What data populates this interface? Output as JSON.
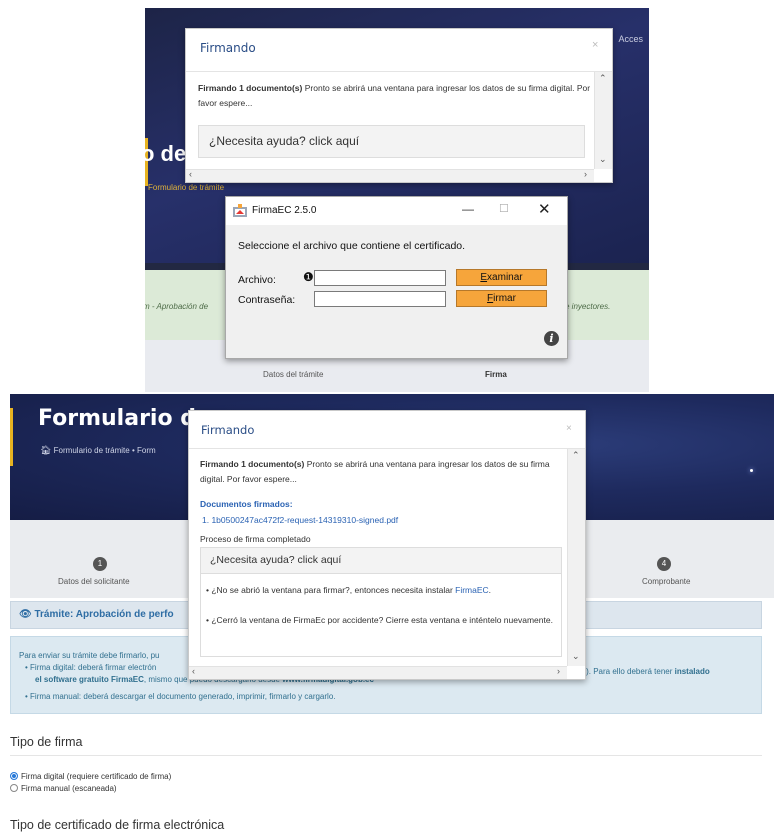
{
  "top": {
    "header_access": "Acces",
    "page_title_partial": "o de",
    "breadcrumb": "Formulario de trámite",
    "green_left": "m - Aprobación de",
    "green_right": "e inyectores.",
    "step_datos": "Datos del trámite",
    "step_firma": "Firma",
    "modal": {
      "title": "Firmando",
      "close": "×",
      "message_bold": "Firmando 1 documento(s)",
      "message_rest": " Pronto se abrirá una ventana para ingresar los datos de su firma digital. Por favor espere...",
      "help_label": "¿Necesita ayuda? click aquí"
    },
    "firmaec": {
      "window_title": "FirmaEC 2.5.0",
      "min": "—",
      "max": "☐",
      "close": "✕",
      "prompt": "Seleccione el archivo que contiene el certificado.",
      "archivo_label": "Archivo:",
      "password_label": "Contraseña:",
      "archivo_value": "",
      "password_value": "",
      "examinar_first": "E",
      "examinar_rest": "xaminar",
      "firmar_first": "F",
      "firmar_rest": "irmar",
      "info_glyph": "i"
    }
  },
  "bottom": {
    "page_title": "Formulario de",
    "breadcrumb_home": "Formulario de trámite",
    "breadcrumb_sep": "•",
    "breadcrumb_next": "Form",
    "step1_num": "1",
    "step1_label": "Datos del solicitante",
    "step4_num": "4",
    "step4_label": "Comprobante",
    "tramite_heading": "Trámite: Aprobación de perfo",
    "info": {
      "line1": "Para enviar su trámite debe firmarlo, pu",
      "line2": "• Firma digital: deberá firmar electrón",
      "line3_bold": "el software gratuito FirmaEC",
      "line3_rest": ", mismo que puedo descargarlo desde ",
      "line3_url": "www.firmadigital.gob.ec",
      "line4": "• Firma manual: deberá descargar el documento generado, imprimir, firmarlo y cargarlo.",
      "right_text": "or). Para ello deberá tener ",
      "right_bold": "instalado"
    },
    "tipo_firma_heading": "Tipo de firma",
    "radio_digital": "Firma digital (requiere certificado de firma)",
    "radio_manual": "Firma manual (escaneada)",
    "tipo_cert_heading": "Tipo de certificado de firma electrónica",
    "modal": {
      "title": "Firmando",
      "close": "×",
      "message_bold": "Firmando 1 documento(s)",
      "message_rest": " Pronto se abrirá una ventana para ingresar los datos de su firma digital. Por favor espere...",
      "docs_heading": "Documentos firmados:",
      "doc_items": [
        "1. 1b0500247ac472f2-request-14319310-signed.pdf"
      ],
      "done_text": "Proceso de firma completado",
      "help_label": "¿Necesita ayuda? click aquí",
      "help_item1_text": "¿No se abrió la ventana para firmar?, entonces necesita instalar ",
      "help_item1_link": "FirmaEC",
      "help_item1_end": ".",
      "help_item2": "¿Cerró la ventana de FirmaEc por accidente? Cierre esta ventana e inténtelo nuevamente."
    }
  }
}
